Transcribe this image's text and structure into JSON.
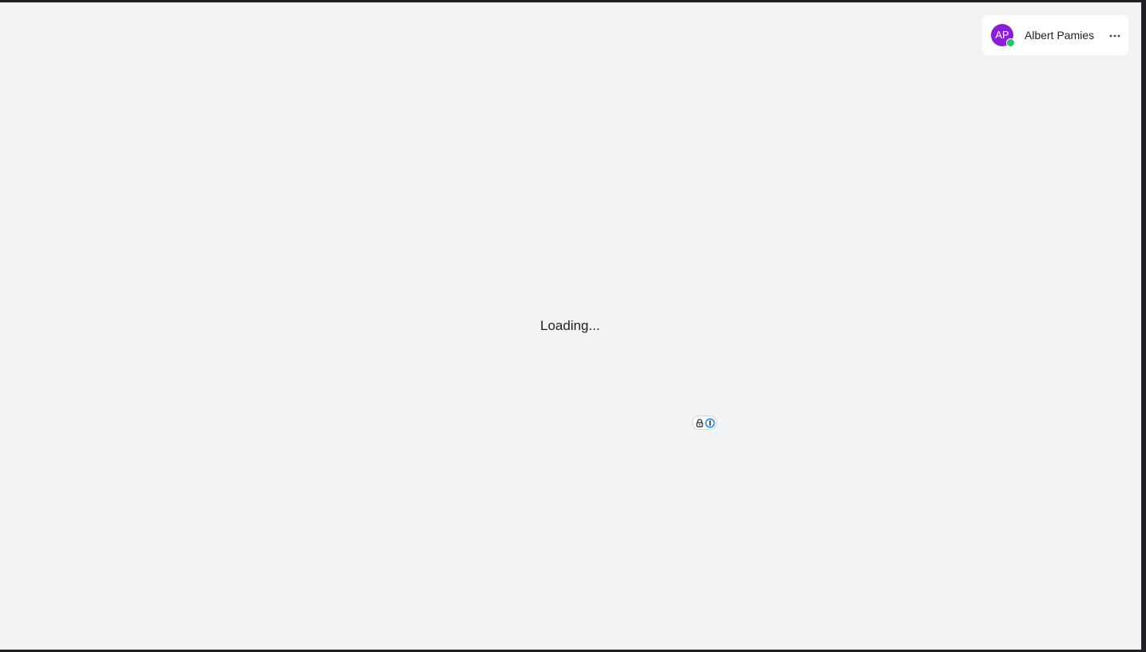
{
  "colors": {
    "page_background": "#f2f3f5",
    "frame": "#1f2023",
    "avatar_background": "#8a1fd9",
    "presence_online": "#22c55e",
    "password_manager_blue": "#1a8cff"
  },
  "user": {
    "initials": "AP",
    "name": "Albert Pamies",
    "presence": "online",
    "more_icon": "ellipsis-horizontal-icon"
  },
  "main": {
    "loading_text": "Loading..."
  },
  "password_manager": {
    "lock_icon": "lock-icon",
    "logo_icon": "password-manager-logo-icon"
  }
}
